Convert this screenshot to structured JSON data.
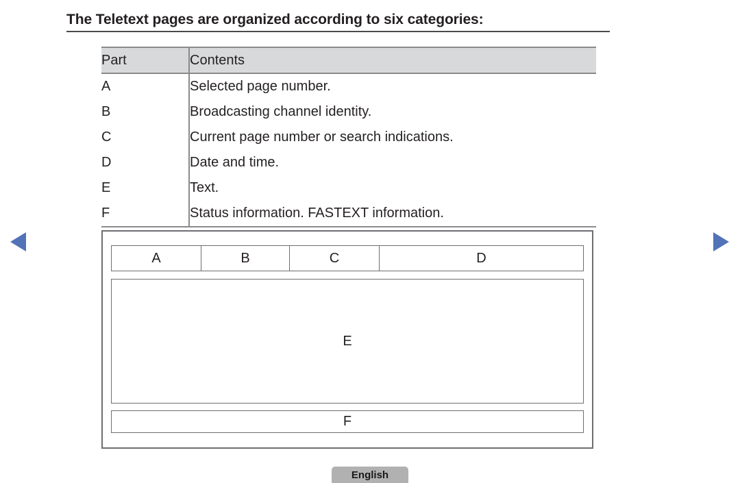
{
  "page": {
    "title": "The Teletext pages are organized according to six categories:"
  },
  "table": {
    "headers": [
      "Part",
      "Contents"
    ],
    "rows": [
      {
        "part": "A",
        "contents": "Selected page number."
      },
      {
        "part": "B",
        "contents": "Broadcasting channel identity."
      },
      {
        "part": "C",
        "contents": "Current page number or search indications."
      },
      {
        "part": "D",
        "contents": "Date and time."
      },
      {
        "part": "E",
        "contents": "Text."
      },
      {
        "part": "F",
        "contents": "Status information. FASTEXT information."
      }
    ]
  },
  "diagram": {
    "top_row": [
      "A",
      "B",
      "C",
      "D"
    ],
    "middle_box": "E",
    "bottom_box": "F"
  },
  "navigation": {
    "prev_icon": "triangle-left-icon",
    "next_icon": "triangle-right-icon",
    "arrow_color": "#5273b8"
  },
  "footer": {
    "language_label": "English"
  },
  "colors": {
    "text": "#231f20",
    "rule": "#4a4a4a",
    "table_border": "#8a8a8a",
    "header_bg": "#d8d9db",
    "diagram_border": "#6d6e71",
    "button_bg": "#b1b1b1"
  }
}
